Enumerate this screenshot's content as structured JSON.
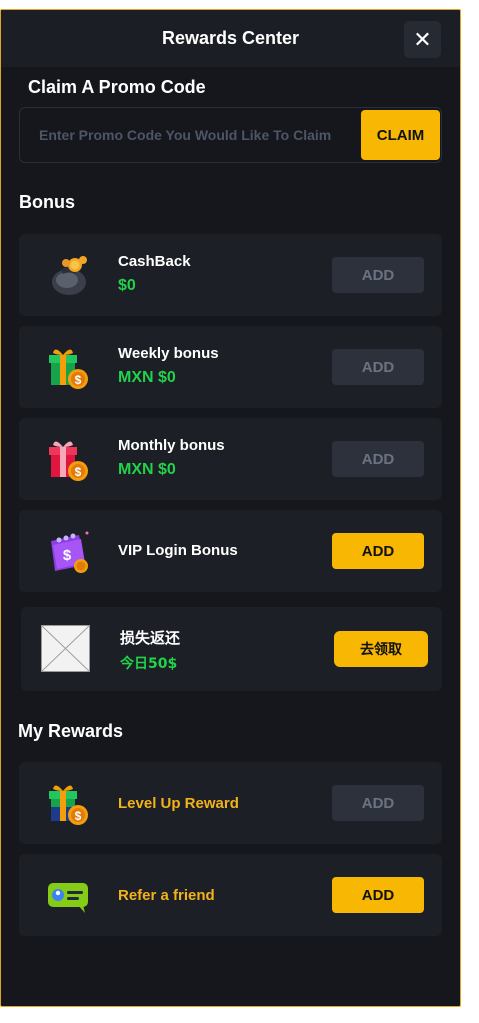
{
  "header": {
    "title": "Rewards Center",
    "close_label": "✕"
  },
  "promo": {
    "section_title": "Claim A Promo Code",
    "placeholder": "Enter Promo Code You Would Like To Claim",
    "claim_label": "CLAIM"
  },
  "bonus": {
    "section_title": "Bonus",
    "items": [
      {
        "title": "CashBack",
        "value": "$0",
        "button": "ADD",
        "button_state": "disabled",
        "icon": "money-bag-icon"
      },
      {
        "title": "Weekly bonus",
        "value": "MXN $0",
        "button": "ADD",
        "button_state": "disabled",
        "icon": "green-gift-coin-icon"
      },
      {
        "title": "Monthly bonus",
        "value": "MXN $0",
        "button": "ADD",
        "button_state": "disabled",
        "icon": "red-gift-coin-icon"
      },
      {
        "title": "VIP Login Bonus",
        "button": "ADD",
        "button_state": "active",
        "icon": "purple-wallet-icon"
      }
    ],
    "loss_rebate": {
      "title": "损失返还",
      "value": "今日50$",
      "button": "去领取",
      "icon": "broken-image-icon"
    }
  },
  "my_rewards": {
    "section_title": "My Rewards",
    "items": [
      {
        "title": "Level Up Reward",
        "button": "ADD",
        "button_state": "disabled",
        "icon": "gift-coin-icon"
      },
      {
        "title": "Refer a friend",
        "button": "ADD",
        "button_state": "active",
        "icon": "refer-card-icon"
      }
    ]
  },
  "colors": {
    "accent": "#f7b702",
    "value_green": "#22d24a",
    "panel_bg": "#15171c",
    "card_bg": "#1c1f25"
  }
}
